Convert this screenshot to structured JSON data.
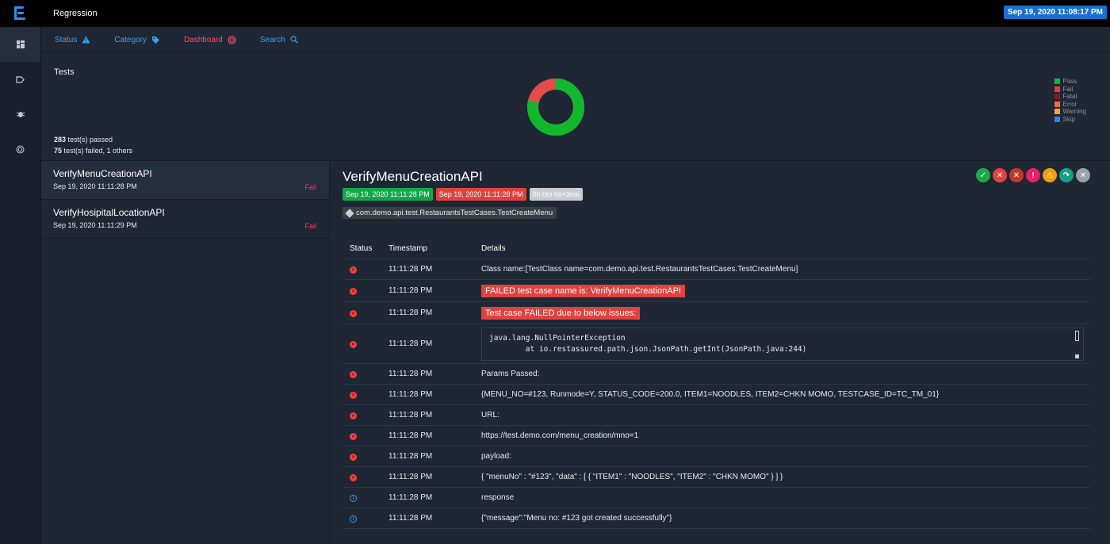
{
  "app": {
    "title": "Regression",
    "datetime": "Sep 19, 2020 11:08:17 PM"
  },
  "icons": {
    "leftnav": [
      "dashboard-grid-icon",
      "tag-icon",
      "bug-icon",
      "target-icon"
    ],
    "tabs": [
      "warning-icon",
      "tag-icon",
      "target-icon",
      "search-icon"
    ]
  },
  "nav": {
    "tabs": [
      {
        "label": "Status"
      },
      {
        "label": "Category"
      },
      {
        "label": "Dashboard"
      },
      {
        "label": "Search"
      }
    ]
  },
  "summary": {
    "title": "Tests",
    "passed_count": "283",
    "passed_text": " test(s) passed",
    "failed_count": "75",
    "failed_text": " test(s) failed, 1 others",
    "legend": [
      {
        "label": "Pass",
        "color": "#11b82d"
      },
      {
        "label": "Fail",
        "color": "#e23d3d"
      },
      {
        "label": "Fatal",
        "color": "#8a1a1a"
      },
      {
        "label": "Error",
        "color": "#f26a55"
      },
      {
        "label": "Warning",
        "color": "#f5a623"
      },
      {
        "label": "Skip",
        "color": "#2f80ed"
      }
    ],
    "donut": {
      "pass": 283,
      "fail": 75,
      "others": 1
    }
  },
  "tests": [
    {
      "name": "VerifyMenuCreationAPI",
      "time": "Sep 19, 2020 11:11:28 PM",
      "status": "Fail"
    },
    {
      "name": "VerifyHosipitalLocationAPI",
      "time": "Sep 19, 2020 11:11:29 PM",
      "status": "Fail"
    }
  ],
  "detail": {
    "title": "VerifyMenuCreationAPI",
    "start": "Sep 19, 2020 11:11:28 PM",
    "end": "Sep 19, 2020 11:11:28 PM",
    "duration": "0h 0m 0s+3ms",
    "tag": "com.demo.api.test.RestaurantsTestCases.TestCreateMenu",
    "filters": [
      {
        "name": "pass-filter-icon",
        "color": "#1fa84a"
      },
      {
        "name": "fail-filter-icon",
        "color": "#e0423f"
      },
      {
        "name": "fatal-filter-icon",
        "color": "#c0392b"
      },
      {
        "name": "error-filter-icon",
        "color": "#e91e63"
      },
      {
        "name": "warning-filter-icon",
        "color": "#f39c12"
      },
      {
        "name": "skip-filter-icon",
        "color": "#16a085"
      },
      {
        "name": "clear-filter-icon",
        "color": "#9aa0a6"
      }
    ],
    "headers": {
      "status": "Status",
      "timestamp": "Timestamp",
      "details": "Details"
    },
    "logs": [
      {
        "status": "fail",
        "time": "11:11:28 PM",
        "type": "text",
        "details": "Class name:[TestClass name=com.demo.api.test.RestaurantsTestCases.TestCreateMenu]"
      },
      {
        "status": "fail",
        "time": "11:11:28 PM",
        "type": "highlight",
        "details": "FAILED test case name is: VerifyMenuCreationAPI"
      },
      {
        "status": "fail",
        "time": "11:11:28 PM",
        "type": "highlight",
        "details": "Test case FAILED due to below issues:"
      },
      {
        "status": "fail",
        "time": "11:11:28 PM",
        "type": "code",
        "details": "java.lang.NullPointerException\n\tat io.restassured.path.json.JsonPath.getInt(JsonPath.java:244)"
      },
      {
        "status": "fail",
        "time": "11:11:28 PM",
        "type": "text",
        "details": "Params Passed:"
      },
      {
        "status": "fail",
        "time": "11:11:28 PM",
        "type": "text",
        "details": "{MENU_NO=#123, Runmode=Y, STATUS_CODE=200.0, ITEM1=NOODLES, ITEM2=CHKN MOMO, TESTCASE_ID=TC_TM_01}"
      },
      {
        "status": "fail",
        "time": "11:11:28 PM",
        "type": "text",
        "details": "URL:"
      },
      {
        "status": "fail",
        "time": "11:11:28 PM",
        "type": "text",
        "details": "https://test.demo.com/menu_creation/mno=1"
      },
      {
        "status": "fail",
        "time": "11:11:28 PM",
        "type": "text",
        "details": "payload:"
      },
      {
        "status": "fail",
        "time": "11:11:28 PM",
        "type": "text",
        "details": "{ \"menuNo\" : \"#123\", \"data\" : [ { \"ITEM1\" : \"NOODLES\", \"ITEM2\" : \"CHKN MOMO\" } ] }"
      },
      {
        "status": "info",
        "time": "11:11:28 PM",
        "type": "text",
        "details": "response"
      },
      {
        "status": "info",
        "time": "11:11:28 PM",
        "type": "text",
        "details": "{\"message\":\"Menu no: #123 got created successfully\"}"
      }
    ]
  }
}
